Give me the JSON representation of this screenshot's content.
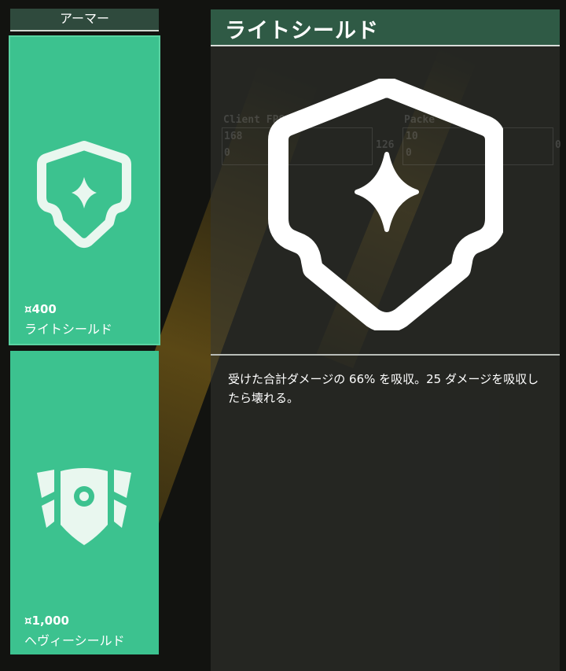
{
  "category": {
    "title": "アーマー"
  },
  "items": [
    {
      "price": "¤400",
      "name": "ライトシールド",
      "icon": "light-shield-icon"
    },
    {
      "price": "¤1,000",
      "name": "ヘヴィーシールド",
      "icon": "heavy-shield-icon"
    }
  ],
  "detail": {
    "title": "ライトシールド",
    "icon": "light-shield-icon",
    "description": "受けた合計ダメージの 66% を吸収。25 ダメージを吸収したら壊れる。"
  },
  "stats_overlay": {
    "client_fps_label": "Client FPS",
    "client_fps_max": "168",
    "client_fps_min": "0",
    "client_fps_current": "126",
    "packet_label": "Packe",
    "packet_max": "10",
    "packet_min": "0",
    "packet_current": "0"
  },
  "colors": {
    "card_green": "#3cc28f",
    "title_bar_green": "#2f5a45",
    "background": "#121310"
  }
}
